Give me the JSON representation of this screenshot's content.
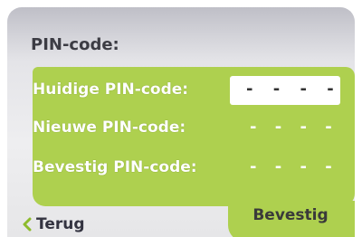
{
  "header": {
    "title": "PIN-code:"
  },
  "form": {
    "current_pin": {
      "label": "Huidige PIN-code:",
      "value": "- - - -"
    },
    "new_pin": {
      "label": "Nieuwe PIN-code:",
      "value": "- - - -"
    },
    "confirm_pin": {
      "label": "Bevestig PIN-code:",
      "value": "- - - -"
    }
  },
  "footer": {
    "back_label": "Terug",
    "back_icon": "chevron-left-icon",
    "confirm_label": "Bevestig"
  },
  "colors": {
    "panel": "#aed04f",
    "label_text": "#ffffff",
    "title_text": "#3c3c44",
    "active_field_bg": "#ffffff",
    "back_icon": "#8dbb2c"
  }
}
